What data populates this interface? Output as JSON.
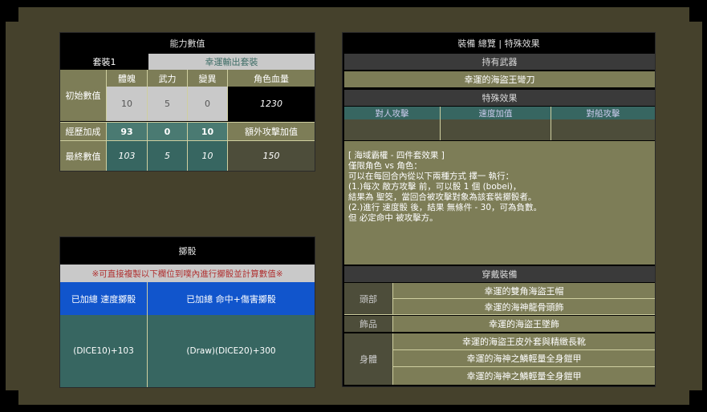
{
  "ability": {
    "title": "能力數值",
    "set_label": "套裝1",
    "set_value": "幸運輸出套裝",
    "col_headers": [
      "體魄",
      "武力",
      "變異",
      "角色血量"
    ],
    "rows": [
      {
        "label": "初始數值",
        "values": [
          "10",
          "5",
          "0",
          "1230"
        ]
      },
      {
        "label": "經歷加成",
        "values": [
          "93",
          "0",
          "10"
        ],
        "extra_header": "額外攻擊加值"
      },
      {
        "label": "最終數值",
        "values": [
          "103",
          "5",
          "10",
          "150"
        ]
      }
    ]
  },
  "dice": {
    "title": "擲骰",
    "notice": "※可直接複製以下欄位到噗內進行擲骰並計算數值※",
    "headers": [
      "已加總 速度擲骰",
      "已加總 命中+傷害擲骰"
    ],
    "values": [
      "(DICE10)+103",
      "(Draw)(DICE20)+300"
    ]
  },
  "equip": {
    "title": "裝備 總覽 | 特殊效果",
    "weapon_header": "持有武器",
    "weapon": "幸運的海盜王彎刀",
    "effect_header": "特殊效果",
    "effect_cols": [
      "對人攻擊",
      "速度加值",
      "對船攻擊"
    ],
    "effect_vals": [
      "",
      "",
      ""
    ],
    "desc_lines": [
      "[ 海域霸權 - 四件套效果 ]",
      "僅限角色 vs 角色：",
      "",
      "可以在每回合內從以下兩種方式 擇一 執行：",
      "",
      "(1.)每次 敵方攻擊 前，可以骰 1 個 (bobei)，",
      "結果為 聖筊，當回合被攻擊對象為該套裝擲骰者。",
      "",
      "(2.)進行 速度骰 後，結果 無條件 - 30，可為負數。",
      "但 必定命中 被攻擊方。"
    ],
    "wear_header": "穿戴裝備",
    "slots": [
      {
        "label": "頭部",
        "items": [
          "幸運的雙角海盜王帽",
          "幸運的海神龍骨頭飾"
        ]
      },
      {
        "label": "飾品",
        "items": [
          "幸運的海盜王墜飾"
        ]
      },
      {
        "label": "身體",
        "items": [
          "幸運的海盜王皮外套與精緻長靴",
          "幸運的海神之鱗輕量全身鎧甲",
          "幸運的海神之鱗輕量全身鎧甲"
        ]
      }
    ]
  }
}
